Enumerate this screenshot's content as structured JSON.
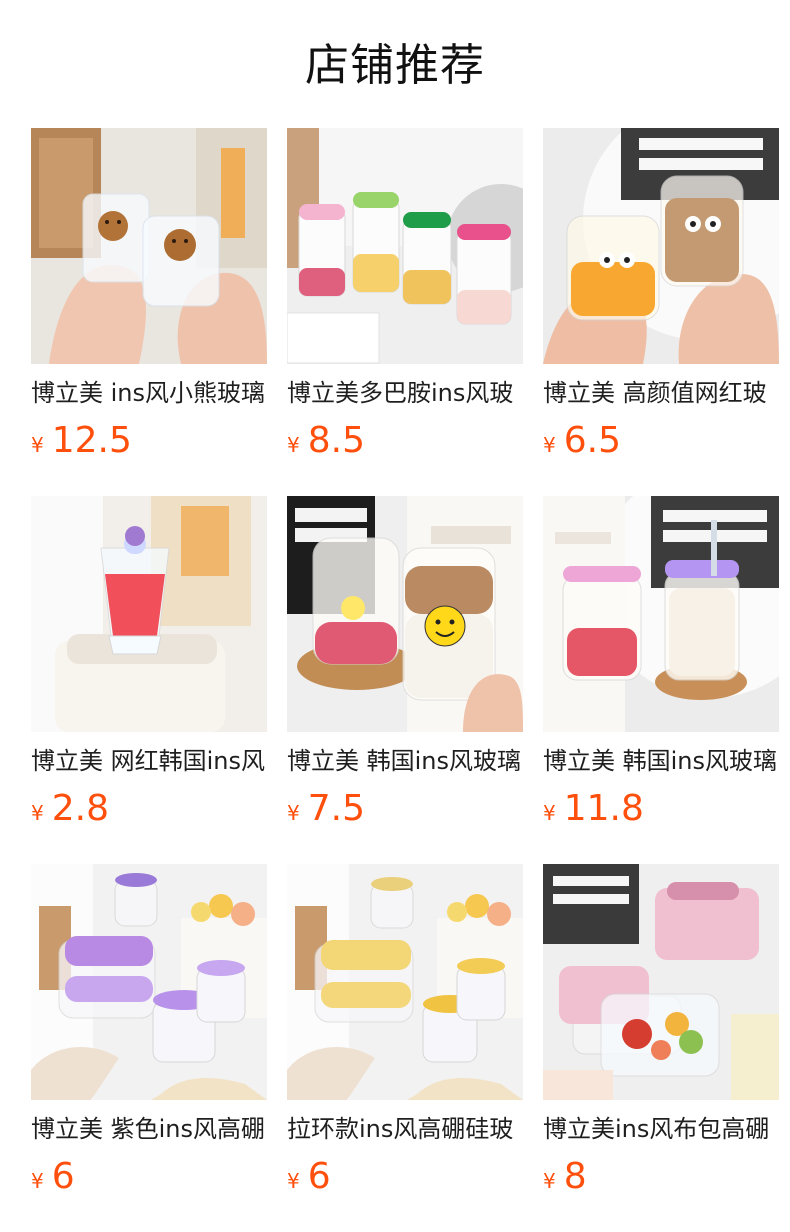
{
  "header": {
    "title": "店铺推荐"
  },
  "products": [
    {
      "name": "博立美 ins风小熊玻璃",
      "currency": "¥",
      "price": "12.5",
      "image_icon": "glass-mug-bear-image"
    },
    {
      "name": "博立美多巴胺ins风玻",
      "currency": "¥",
      "price": "8.5",
      "image_icon": "drink-bottle-image"
    },
    {
      "name": "博立美 高颜值网红玻",
      "currency": "¥",
      "price": "6.5",
      "image_icon": "cute-cup-image"
    },
    {
      "name": "博立美 网红韩国ins风",
      "currency": "¥",
      "price": "2.8",
      "image_icon": "red-glass-image"
    },
    {
      "name": "博立美 韩国ins风玻璃",
      "currency": "¥",
      "price": "7.5",
      "image_icon": "smile-cup-image"
    },
    {
      "name": "博立美 韩国ins风玻璃",
      "currency": "¥",
      "price": "11.8",
      "image_icon": "lidded-jar-image"
    },
    {
      "name": "博立美 紫色ins风高硼",
      "currency": "¥",
      "price": "6",
      "image_icon": "purple-container-image"
    },
    {
      "name": "拉环款ins风高硼硅玻",
      "currency": "¥",
      "price": "6",
      "image_icon": "yellow-container-image"
    },
    {
      "name": "博立美ins风布包高硼",
      "currency": "¥",
      "price": "8",
      "image_icon": "lunch-box-image"
    }
  ],
  "colors": {
    "accent": "#ff4f0d",
    "text": "#1f1f1f"
  }
}
